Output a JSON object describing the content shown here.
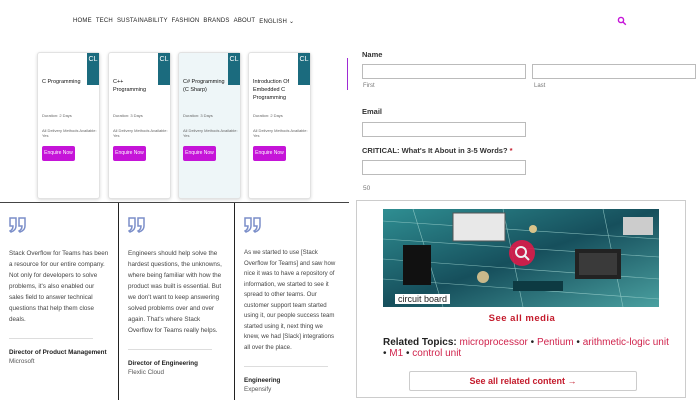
{
  "nav": {
    "items": [
      "HOME",
      "TECH",
      "SUSTAINABILITY",
      "FASHION",
      "BRANDS",
      "ABOUT",
      "ENGLISH"
    ]
  },
  "courses": [
    {
      "title": "C Programming",
      "duration": "Duration: 2 Days",
      "delivery": "All Delivery Methods Available: Yes",
      "cta": "Enquire Now",
      "badge": "CL"
    },
    {
      "title": "C++ Programming",
      "duration": "Duration: 3 Days",
      "delivery": "All Delivery Methods Available: Yes",
      "cta": "Enquire Now",
      "badge": "CL"
    },
    {
      "title": "C# Programming (C Sharp)",
      "duration": "Duration: 3 Days",
      "delivery": "All Delivery Methods Available: Yes",
      "cta": "Enquire Now",
      "badge": "CL"
    },
    {
      "title": "Introduction Of Embedded C Programming",
      "duration": "Duration: 2 Days",
      "delivery": "All Delivery Methods Available: Yes",
      "cta": "Enquire Now",
      "badge": "CL"
    }
  ],
  "form": {
    "name_label": "Name",
    "first_label": "First",
    "last_label": "Last",
    "email_label": "Email",
    "critical_label": "CRITICAL: What's It About in 3-5 Words?",
    "required_mark": "*",
    "counter": "50"
  },
  "testimonials": [
    {
      "text": "Stack Overflow for Teams has been a resource for our entire company. Not only for developers to solve problems, it's also enabled our sales field to answer technical questions that help them close deals.",
      "name": "Director of Product Management",
      "company": "Microsoft"
    },
    {
      "text": "Engineers should help solve the hardest questions, the unknowns, where being familiar with how the product was built is essential. But we don't want to keep answering solved problems over and over again. That's where Stack Overflow for Teams really helps.",
      "name": "Director of Engineering",
      "company": "Flexlic Cloud"
    },
    {
      "text": "As we started to use [Stack Overflow for Teams] and saw how nice it was to have a repository of information, we started to see it spread to other teams. Our customer support team started using it, our people success team started using it, next thing we knew, we had [Slack] integrations all over the place.",
      "name": "Engineering",
      "company": "Expensify"
    }
  ],
  "media": {
    "caption": "circuit board",
    "see_all": "See all media",
    "related_label": "Related Topics:",
    "related_links": [
      "microprocessor",
      "Pentium",
      "arithmetic-logic unit",
      "M1",
      "control unit"
    ],
    "separator": "•",
    "see_related": "See all related content",
    "see_related_arrow": "→"
  },
  "colors": {
    "accent_purple": "#c514d8",
    "badge_teal": "#1b6b7e",
    "link_red": "#c41b2c",
    "quote_blue": "#7b8ec9"
  }
}
